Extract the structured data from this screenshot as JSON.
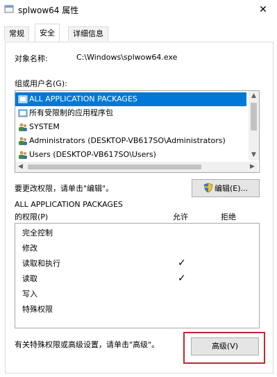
{
  "window": {
    "title": "splwow64 属性",
    "close_glyph": "✕"
  },
  "tabs": [
    {
      "label": "常规"
    },
    {
      "label": "安全"
    },
    {
      "label": "详细信息"
    }
  ],
  "object": {
    "label": "对象名称:",
    "value": "C:\\Windows\\splwow64.exe"
  },
  "groups": {
    "label": "组或用户名(G):",
    "items": [
      {
        "label": "ALL APPLICATION PACKAGES",
        "icon": "package-icon",
        "selected": true
      },
      {
        "label": "所有受限制的应用程序包",
        "icon": "package-icon",
        "selected": false
      },
      {
        "label": "SYSTEM",
        "icon": "users-icon",
        "selected": false
      },
      {
        "label": "Administrators (DESKTOP-VB617SO\\Administrators)",
        "icon": "users-icon",
        "selected": false
      },
      {
        "label": "Users (DESKTOP-VB617SO\\Users)",
        "icon": "users-icon",
        "selected": false
      }
    ]
  },
  "edit": {
    "hint": "要更改权限，请单击\"编辑\"。",
    "button_label": "编辑(E)..."
  },
  "permissions": {
    "title": "ALL APPLICATION PACKAGES",
    "subtitle": "的权限(P)",
    "allow_header": "允许",
    "deny_header": "拒绝",
    "rows": [
      {
        "name": "完全控制",
        "allow": false,
        "deny": false
      },
      {
        "name": "修改",
        "allow": false,
        "deny": false
      },
      {
        "name": "读取和执行",
        "allow": true,
        "deny": false
      },
      {
        "name": "读取",
        "allow": true,
        "deny": false
      },
      {
        "name": "写入",
        "allow": false,
        "deny": false
      },
      {
        "name": "特殊权限",
        "allow": false,
        "deny": false
      }
    ],
    "check_glyph": "✓"
  },
  "advanced": {
    "hint": "有关特殊权限或高级设置，请单击\"高级\"。",
    "button_label": "高级(V)"
  },
  "colors": {
    "selection": "#0078d7",
    "highlight_border": "#c1272d"
  }
}
